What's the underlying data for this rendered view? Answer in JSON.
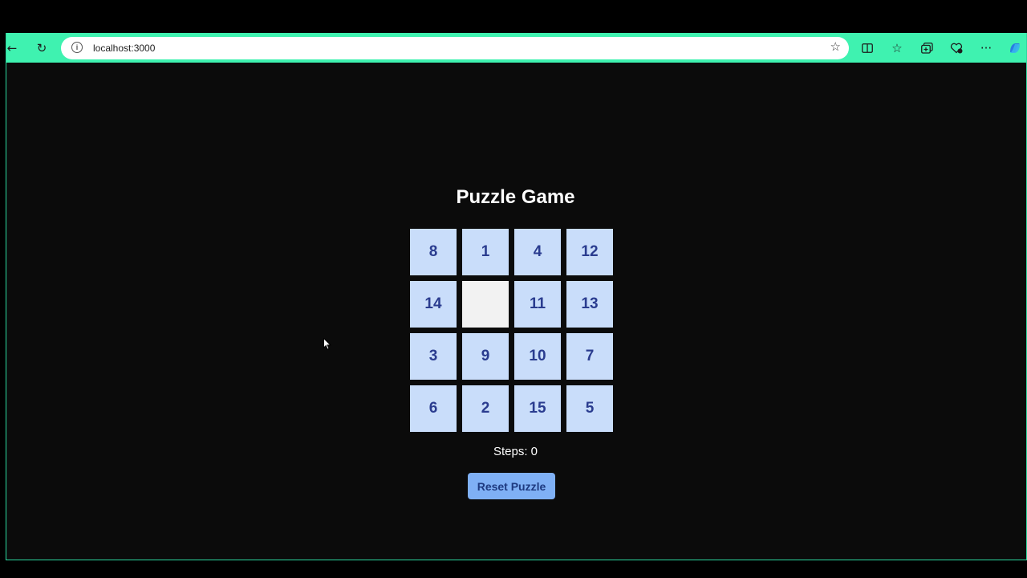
{
  "browser": {
    "url": "localhost:3000",
    "toolbar_color": "#3ff2b0",
    "icons": {
      "back": "back-arrow-icon",
      "refresh": "refresh-icon",
      "info": "info-icon",
      "favorite": "star-icon",
      "split_screen": "split-screen-icon",
      "favorites": "favorites-icon",
      "collections": "collections-icon",
      "extensions": "extensions-icon",
      "more": "more-icon",
      "copilot": "copilot-icon"
    }
  },
  "page": {
    "title": "Puzzle Game",
    "board": {
      "rows": [
        [
          "8",
          "1",
          "4",
          "12"
        ],
        [
          "14",
          "",
          "11",
          "13"
        ],
        [
          "3",
          "9",
          "10",
          "7"
        ],
        [
          "6",
          "2",
          "15",
          "5"
        ]
      ],
      "tile_color": "#c9ddfa",
      "number_color": "#2a3c8f",
      "empty_color": "#f2f2f2"
    },
    "steps_text": "Steps: 0",
    "reset_label": "Reset Puzzle",
    "reset_color": "#7fb0f5"
  }
}
